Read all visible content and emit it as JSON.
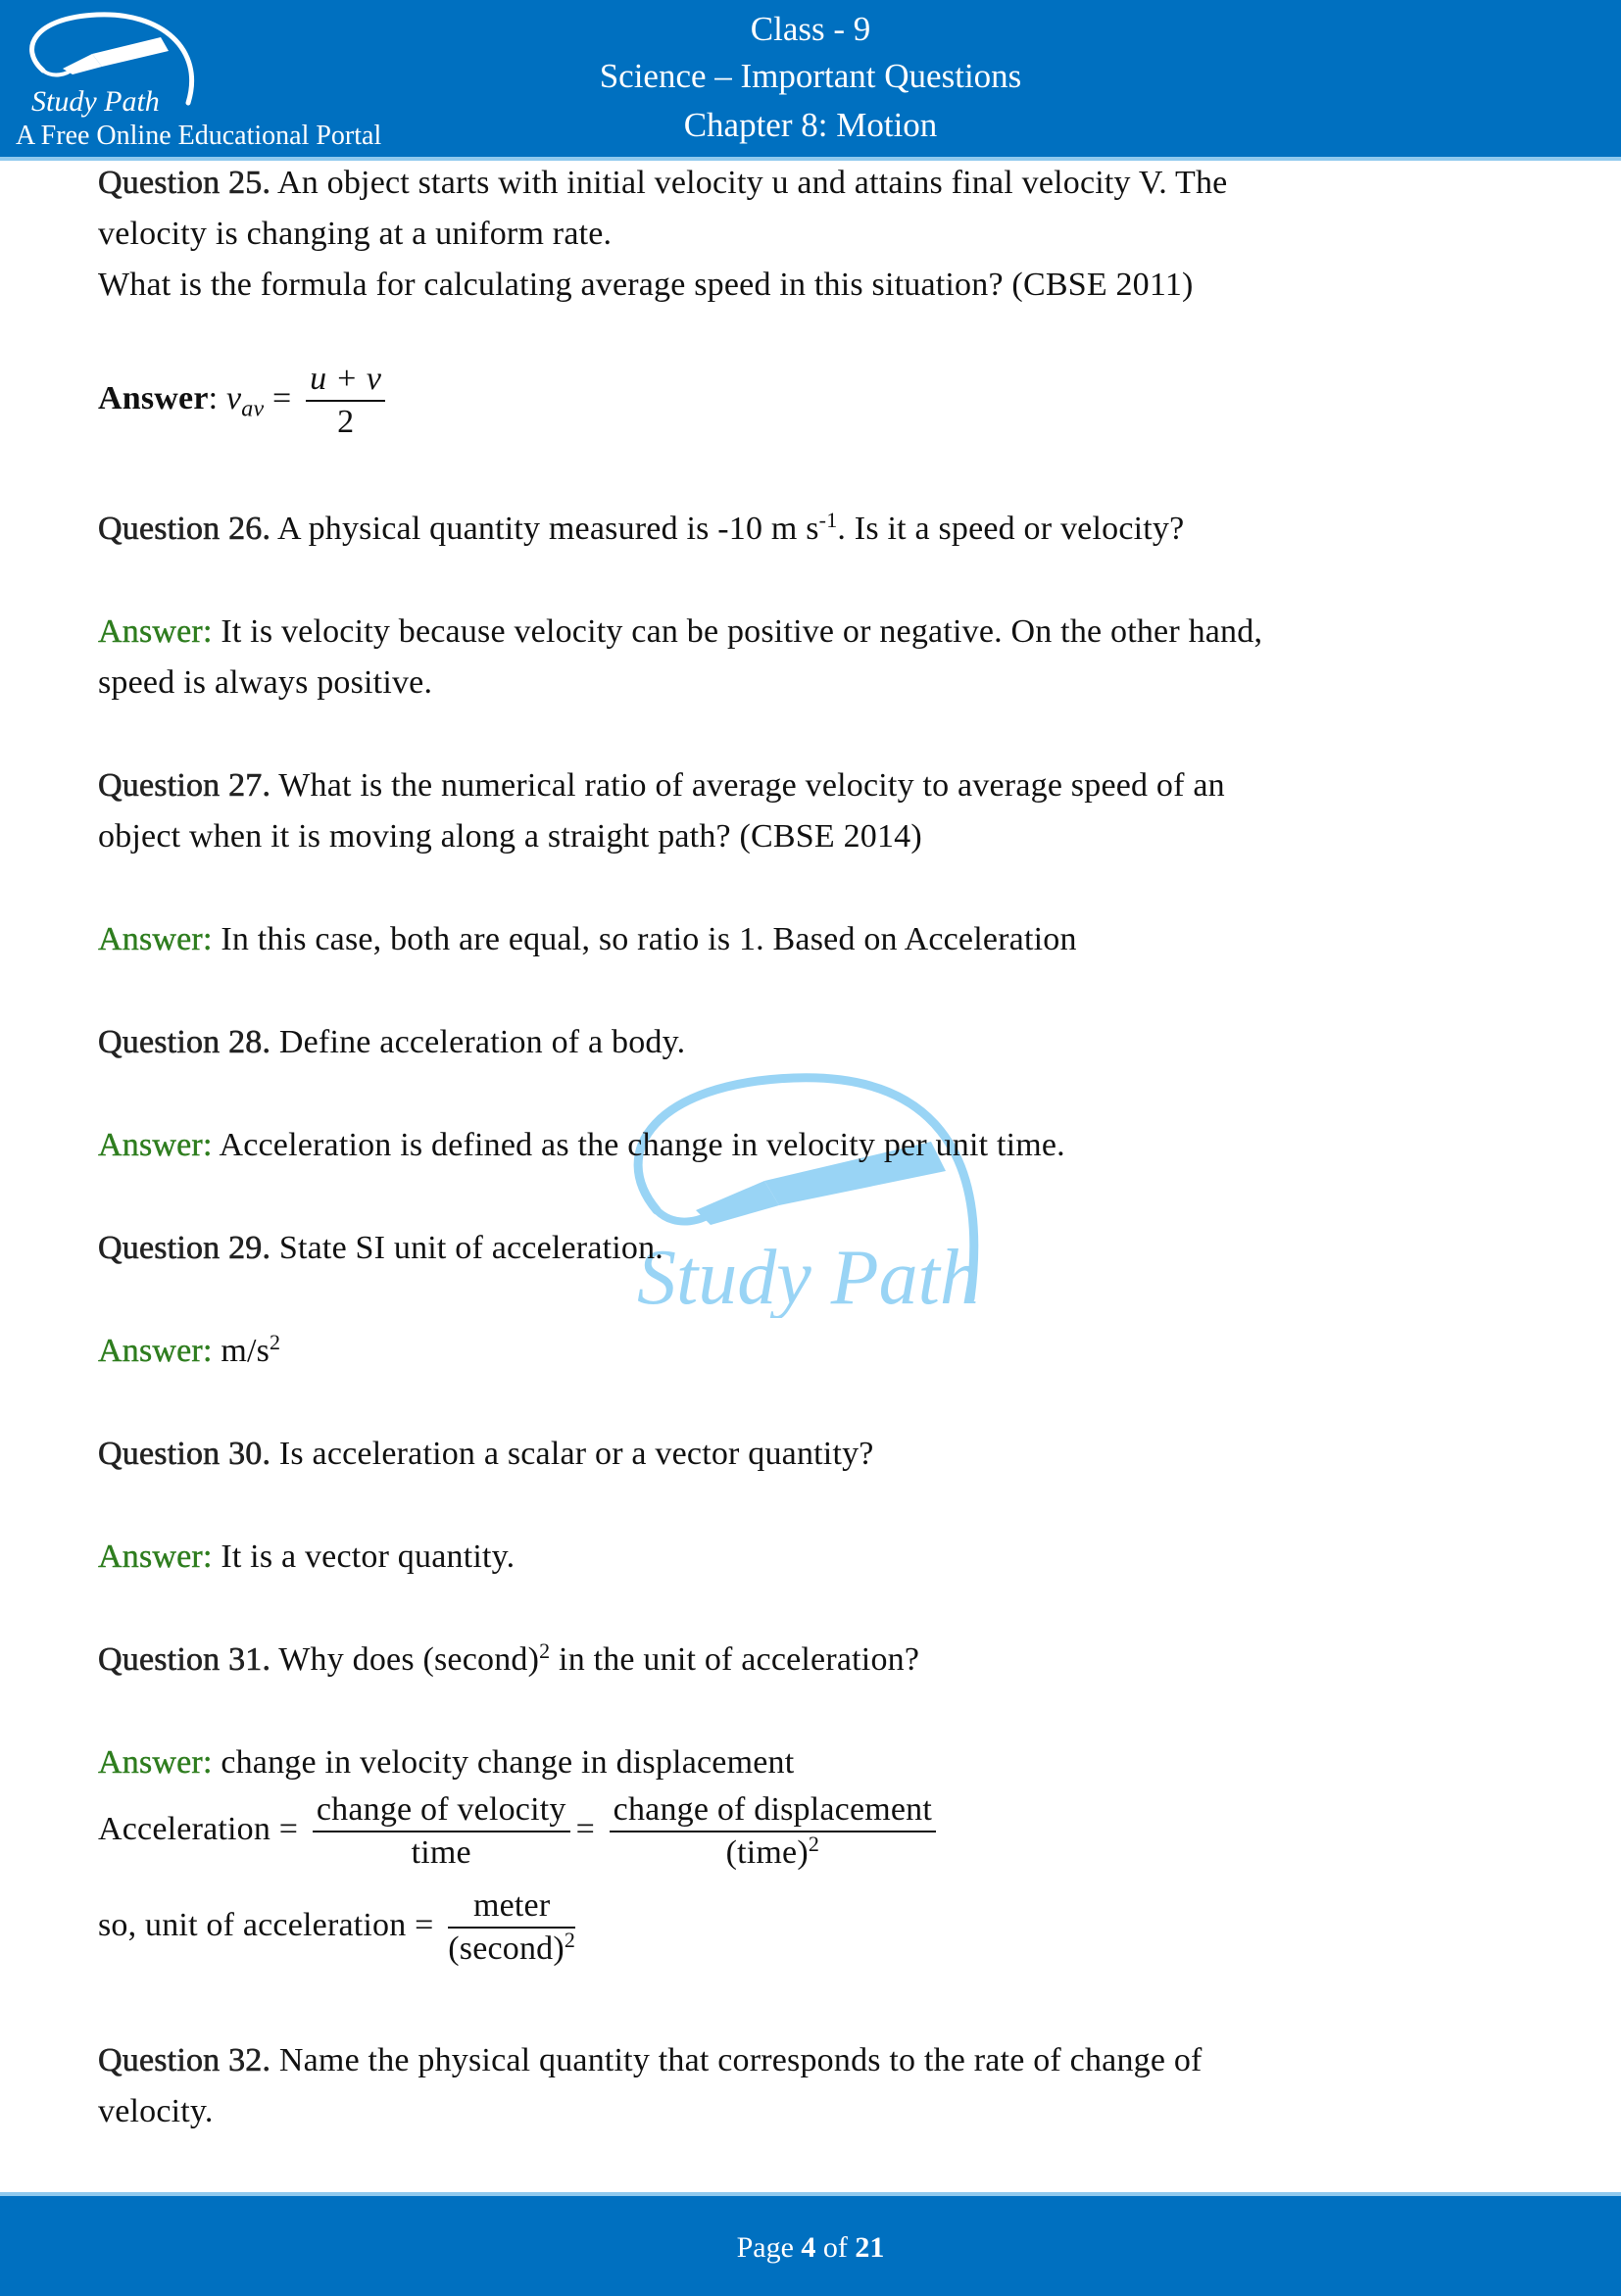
{
  "header": {
    "class_title": "Class - 9",
    "subject_title": "Science – Important Questions",
    "chapter_title": "Chapter 8: Motion",
    "logo_text": "Study Path",
    "tagline": "A Free Online Educational Portal"
  },
  "watermark": {
    "text": "Study Path"
  },
  "colors": {
    "brand_blue": "#0070c0",
    "answer_green": "#2e7d1e",
    "watermark_blue": "#8fd0f5"
  },
  "questions": [
    {
      "label": "Question 25.",
      "lines": [
        "An object starts with initial velocity u and attains final velocity V. The",
        "velocity is changing at a uniform rate.",
        "What is the formula for calculating average speed in this situation? (CBSE 2011)"
      ],
      "answer_label": "Answer",
      "answer_formula": {
        "lhs": "v",
        "lhs_sub": "av",
        "numerator": "u + v",
        "denominator": "2"
      }
    },
    {
      "label": "Question 26.",
      "text_before": "A physical quantity measured is -10 m s",
      "sup": "-1",
      "text_after": ". Is it a speed or velocity?",
      "answer_label": "Answer:",
      "answer_lines": [
        "It is velocity because velocity can be positive or negative. On the other hand,",
        "speed is always positive."
      ]
    },
    {
      "label": "Question 27.",
      "lines": [
        "What is the numerical ratio of average velocity to average speed of an",
        "object when it is moving along a straight path? (CBSE 2014)"
      ],
      "answer_label": "Answer:",
      "answer": "In this case, both are equal, so ratio is 1. Based on Acceleration"
    },
    {
      "label": "Question 28.",
      "text": "Define acceleration of a body.",
      "answer_label": "Answer:",
      "answer": "Acceleration is defined as the change in velocity per unit time."
    },
    {
      "label": "Question 29.",
      "text": "State SI unit of acceleration.",
      "answer_label": "Answer:",
      "answer": "m/s",
      "answer_sup": "2"
    },
    {
      "label": "Question 30.",
      "text": "Is acceleration a scalar or a vector quantity?",
      "answer_label": "Answer:",
      "answer": "It is a vector quantity."
    },
    {
      "label": "Question 31.",
      "text_before": "Why does (second)",
      "sup": "2",
      "text_after": " in the unit of acceleration?",
      "answer_label": "Answer:",
      "answer": "change in velocity change in displacement",
      "eq1": {
        "lhs": "Acceleration =",
        "frac1_num": "change of velocity",
        "frac1_den": "time",
        "eq": "=",
        "frac2_num": "change of displacement",
        "frac2_den": "(time)",
        "frac2_den_sup": "2"
      },
      "eq2": {
        "lhs": "so, unit of acceleration =",
        "num": "meter",
        "den": "(second)",
        "den_sup": "2"
      }
    },
    {
      "label": "Question 32.",
      "lines": [
        "Name the physical quantity that corresponds to the rate of change of",
        "velocity."
      ]
    }
  ],
  "footer": {
    "page_prefix": "Page ",
    "page_current": "4",
    "page_of": " of ",
    "page_total": "21"
  }
}
